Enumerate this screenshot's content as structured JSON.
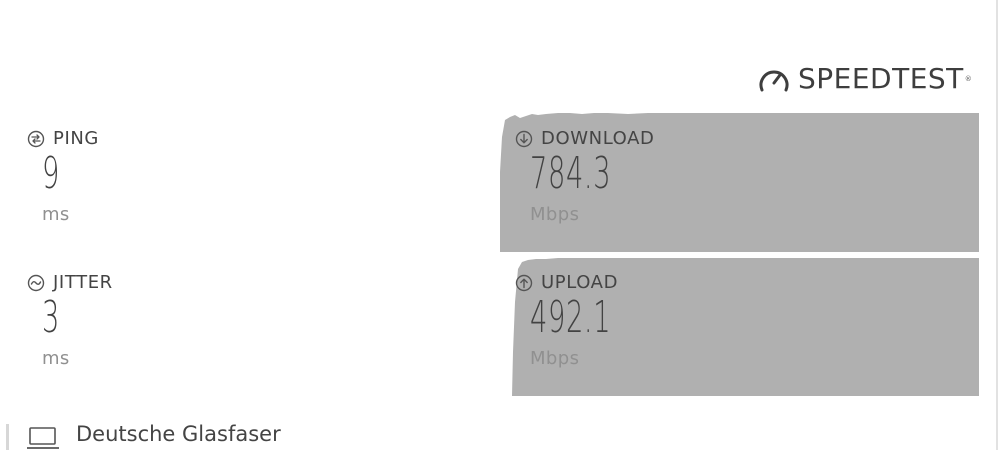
{
  "brand": {
    "name": "SPEEDTEST",
    "mark": "®",
    "icon": "gauge-icon"
  },
  "metrics": {
    "ping": {
      "label": "PING",
      "value": "9",
      "unit": "ms",
      "icon": "ping-icon"
    },
    "jitter": {
      "label": "JITTER",
      "value": "3",
      "unit": "ms",
      "icon": "jitter-icon"
    },
    "download": {
      "label": "DOWNLOAD",
      "value": "784.3",
      "unit": "Mbps",
      "icon": "download-arrow-icon"
    },
    "upload": {
      "label": "UPLOAD",
      "value": "492.1",
      "unit": "Mbps",
      "icon": "upload-arrow-icon"
    }
  },
  "isp": {
    "name": "Deutsche Glasfaser",
    "icon": "laptop-icon"
  },
  "colors": {
    "graph_fill": "#b0b0b0",
    "text_dark": "#444444",
    "text_muted": "#909090",
    "background": "#ffffff"
  }
}
